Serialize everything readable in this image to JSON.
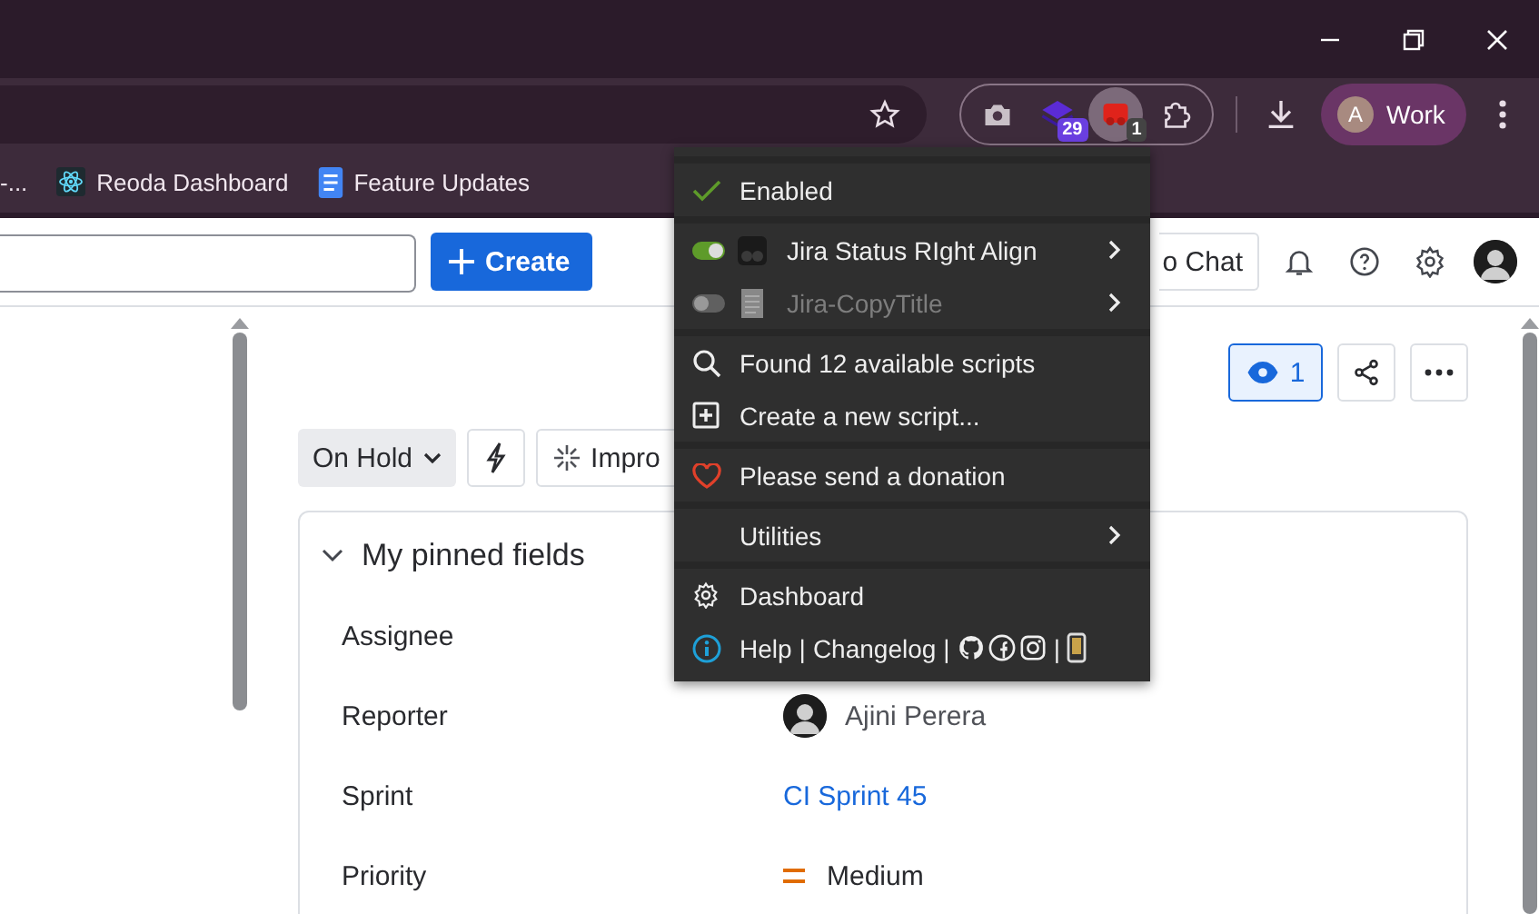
{
  "toolbar": {
    "extensions": [
      {
        "kind": "camera",
        "selected": false
      },
      {
        "kind": "stack",
        "badge": "29",
        "selected": false
      },
      {
        "kind": "script",
        "badge": "1",
        "selected": true
      },
      {
        "kind": "puzzle",
        "selected": false
      }
    ],
    "profile": {
      "initial": "A",
      "label": "Work"
    }
  },
  "bookmarks": [
    {
      "label": "-...",
      "kind": "plain"
    },
    {
      "label": "Reoda Dashboard",
      "kind": "react"
    },
    {
      "label": "Feature Updates",
      "kind": "doc"
    }
  ],
  "menu": {
    "sections": [
      [
        {
          "kind": "check",
          "label": "Enabled",
          "checked": true
        }
      ],
      [
        {
          "kind": "script",
          "label": "Jira Status RIght Align",
          "on": true
        },
        {
          "kind": "script",
          "label": "Jira-CopyTitle",
          "on": false
        }
      ],
      [
        {
          "kind": "search",
          "label": "Found 12 available scripts"
        },
        {
          "kind": "add",
          "label": "Create a new script..."
        }
      ],
      [
        {
          "kind": "heart",
          "label": "Please send a donation"
        }
      ],
      [
        {
          "kind": "submenu",
          "label": "Utilities"
        }
      ],
      [
        {
          "kind": "gear",
          "label": "Dashboard"
        },
        {
          "kind": "links",
          "links": [
            "Help",
            "Changelog"
          ],
          "separator": "|"
        }
      ]
    ]
  },
  "header": {
    "create": "Create",
    "chat": "o Chat"
  },
  "issue": {
    "watchers": "1",
    "status": "On Hold",
    "improve": "Impro"
  },
  "pinned": {
    "title": "My pinned fields",
    "expanded": true,
    "fields": [
      {
        "label": "Assignee",
        "kind": "hidden"
      },
      {
        "label": "Reporter",
        "kind": "user",
        "value": "Ajini Perera"
      },
      {
        "label": "Sprint",
        "kind": "link",
        "value": "CI Sprint 45"
      },
      {
        "label": "Priority",
        "kind": "priority",
        "value": "Medium"
      }
    ]
  }
}
